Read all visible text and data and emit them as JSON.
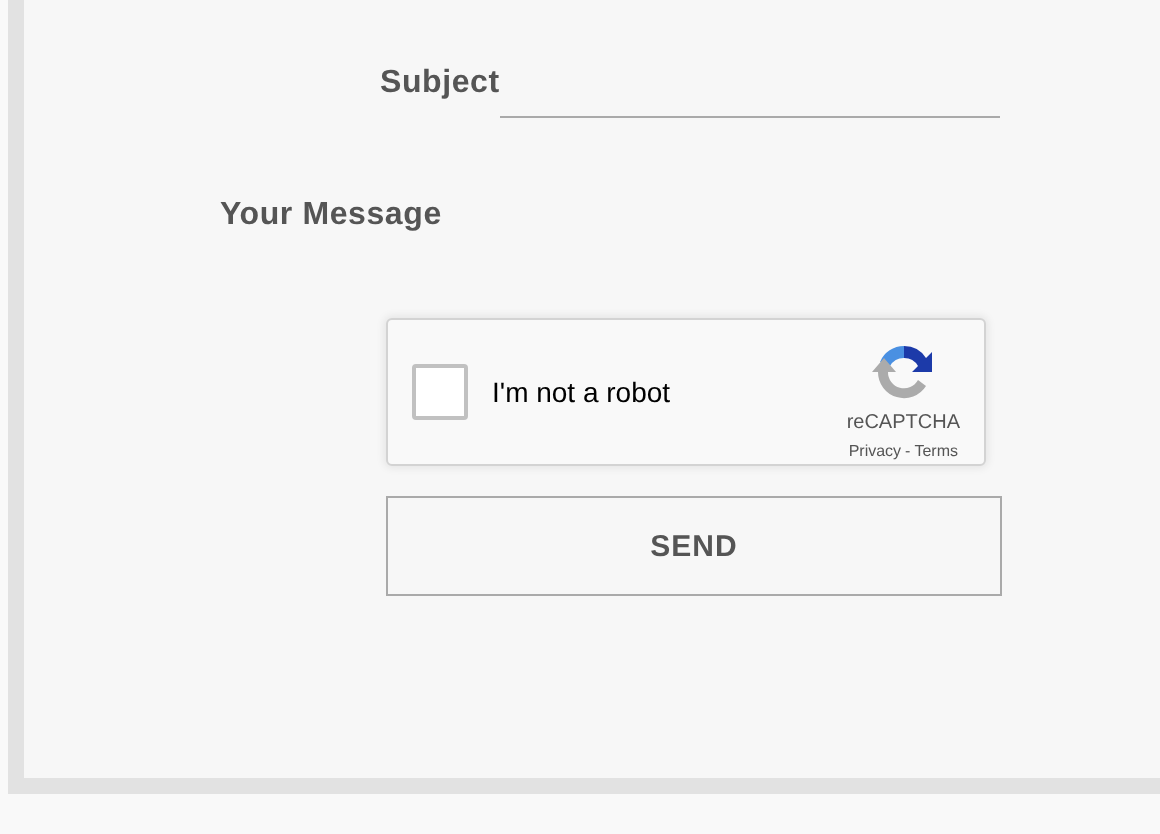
{
  "form": {
    "subject": {
      "label": "Subject"
    },
    "message": {
      "label": "Your Message"
    },
    "captcha": {
      "checked": false,
      "label": "I'm not a robot",
      "brand": "reCAPTCHA",
      "privacy": "Privacy",
      "separator": "-",
      "terms": "Terms"
    },
    "send_button": "SEND"
  }
}
